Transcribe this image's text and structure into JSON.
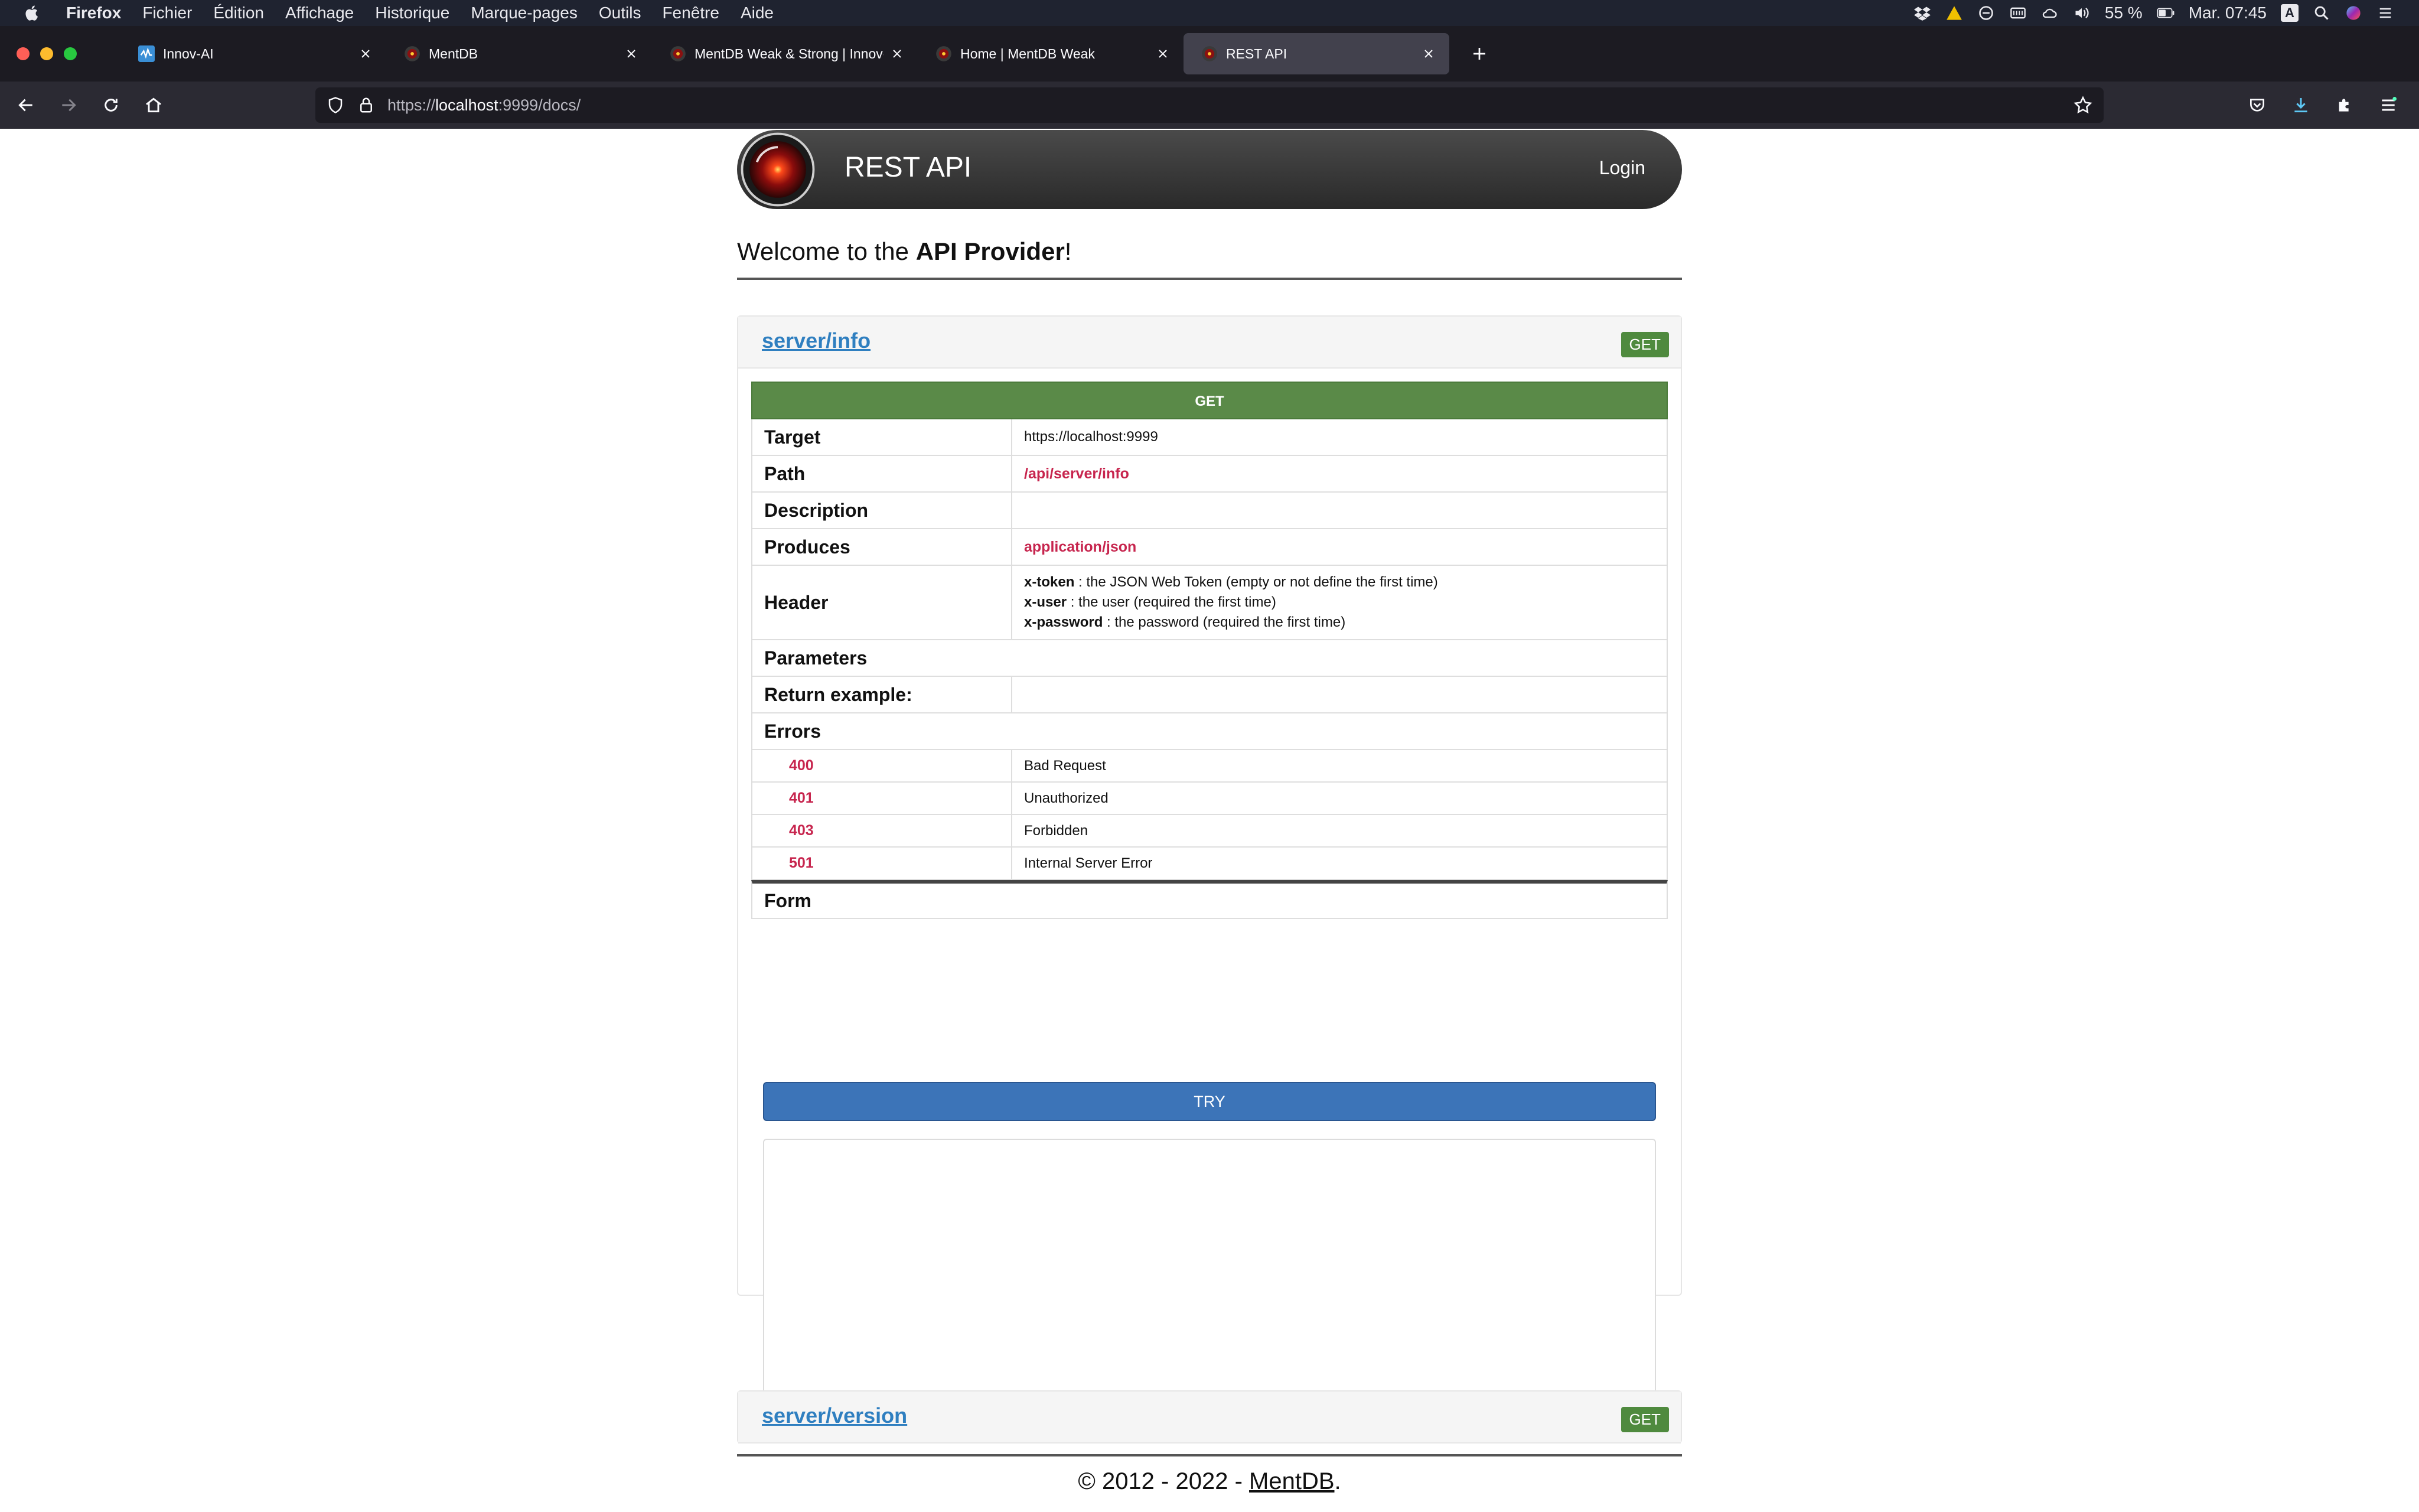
{
  "menubar": {
    "app": "Firefox",
    "items": [
      "Fichier",
      "Édition",
      "Affichage",
      "Historique",
      "Marque-pages",
      "Outils",
      "Fenêtre",
      "Aide"
    ],
    "battery": "55 %",
    "clock": "Mar. 07:45",
    "input_source": "A"
  },
  "tabs": [
    {
      "label": "Innov-AI",
      "active": false
    },
    {
      "label": "MentDB",
      "active": false
    },
    {
      "label": "MentDB Weak & Strong | Innov-AI",
      "active": false
    },
    {
      "label": "Home | MentDB Weak",
      "active": false
    },
    {
      "label": "REST API",
      "active": true
    }
  ],
  "address": {
    "prefix": "https://",
    "host": "localhost",
    "rest": ":9999/docs/"
  },
  "header": {
    "title": "REST API",
    "login": "Login"
  },
  "welcome": {
    "prefix": "Welcome to the ",
    "strong": "API Provider",
    "suffix": "!"
  },
  "endpoint1": {
    "name": "server/info",
    "badge": "GET",
    "method": "GET",
    "rows": {
      "target_label": "Target",
      "target_value": "https://localhost:9999",
      "path_label": "Path",
      "path_value": "/api/server/info",
      "description_label": "Description",
      "description_value": "",
      "produces_label": "Produces",
      "produces_value": "application/json",
      "header_label": "Header",
      "header_lines": [
        {
          "key": "x-token",
          "text": " : the JSON Web Token (empty or not define the first time)"
        },
        {
          "key": "x-user",
          "text": " : the user (required the first time)"
        },
        {
          "key": "x-password",
          "text": " : the password (required the first time)"
        }
      ],
      "parameters_label": "Parameters",
      "return_label": "Return example:",
      "return_value": "",
      "errors_label": "Errors"
    },
    "errors": [
      {
        "code": "400",
        "text": "Bad Request"
      },
      {
        "code": "401",
        "text": "Unauthorized"
      },
      {
        "code": "403",
        "text": "Forbidden"
      },
      {
        "code": "501",
        "text": "Internal Server Error"
      }
    ],
    "form_label": "Form",
    "try_label": "TRY",
    "textarea_value": ""
  },
  "endpoint2": {
    "name": "server/version",
    "badge": "GET"
  },
  "footer": {
    "prefix": "© 2012 - 2022 - ",
    "link": "MentDB",
    "suffix": "."
  }
}
